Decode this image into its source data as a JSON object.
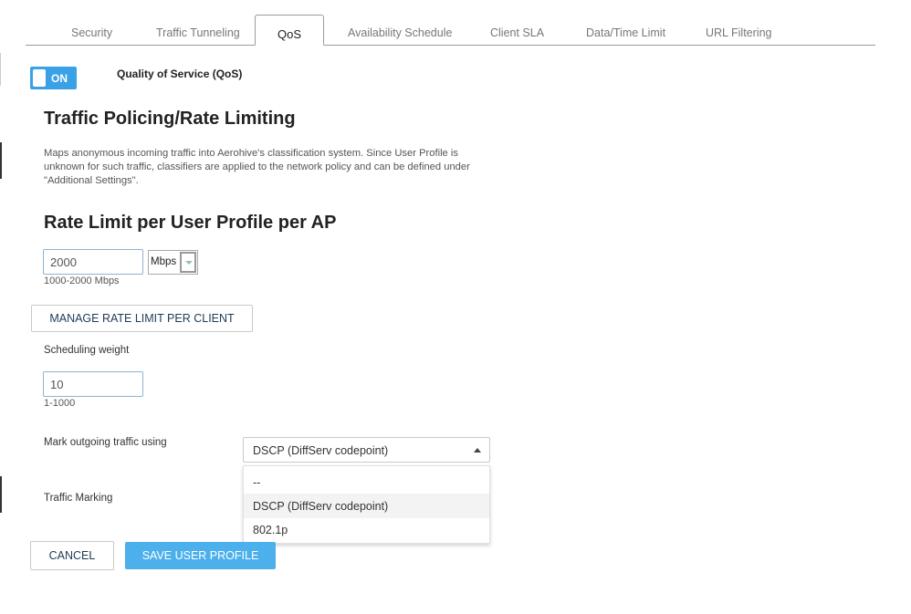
{
  "tabs": [
    {
      "label": "Security"
    },
    {
      "label": "Traffic Tunneling"
    },
    {
      "label": "QoS",
      "active": true
    },
    {
      "label": "Availability Schedule"
    },
    {
      "label": "Client SLA"
    },
    {
      "label": "Data/Time Limit"
    },
    {
      "label": "URL Filtering"
    }
  ],
  "qos": {
    "toggle_state": "ON",
    "label": "Quality of Service (QoS)"
  },
  "policing": {
    "title": "Traffic Policing/Rate Limiting",
    "description": "Maps anonymous incoming traffic into Aerohive's classification system. Since User Profile is unknown for such traffic, classifiers are applied to the network policy and can be defined under \"Additional Settings\"."
  },
  "rate_limit": {
    "title": "Rate Limit per User Profile per AP",
    "value": "2000",
    "unit": "Mbps",
    "hint": "1000-2000 Mbps",
    "manage_button": "MANAGE RATE LIMIT PER CLIENT"
  },
  "scheduling": {
    "label": "Scheduling weight",
    "value": "10",
    "hint": "1-1000"
  },
  "marking": {
    "label": "Mark outgoing traffic using",
    "selected": "DSCP (DiffServ codepoint)",
    "options": [
      "--",
      "DSCP (DiffServ codepoint)",
      "802.1p"
    ],
    "traffic_marking_label": "Traffic Marking"
  },
  "actions": {
    "cancel": "CANCEL",
    "save": "SAVE USER PROFILE"
  },
  "colors": {
    "accent": "#3aa1e6",
    "primary_button": "#4cb0ec"
  }
}
